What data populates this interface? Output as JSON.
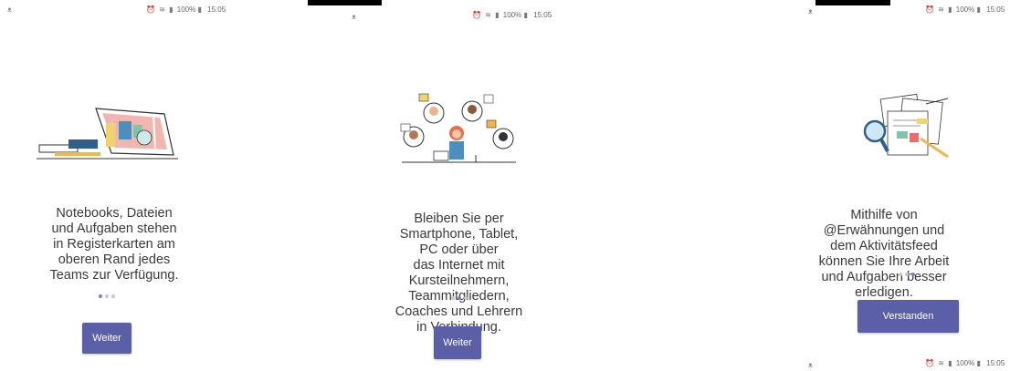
{
  "status": {
    "left_icon": "ᴥ",
    "signal": "100%",
    "time": "15:05"
  },
  "screens": [
    {
      "lines": [
        "Notebooks, Dateien",
        "und Aufgaben stehen",
        "in Registerkarten am",
        "oberen Rand jedes",
        "Teams zur Verfügung."
      ],
      "button": "Weiter",
      "active_dot": 0
    },
    {
      "lines": [
        "Bleiben Sie per",
        "Smartphone, Tablet,",
        "PC oder über",
        "das Internet mit",
        "Kursteilnehmern,",
        "Teammitgliedern,",
        "Coaches und Lehrern",
        "in Verbindung."
      ],
      "button": "Weiter",
      "active_dot": 1
    },
    {
      "lines": [
        "Mithilfe von",
        "@Erwähnungen und",
        "dem Aktivitätsfeed",
        "können Sie Ihre Arbeit",
        "und Aufgaben besser",
        "erledigen."
      ],
      "button": "Verstanden",
      "active_dot": 2
    }
  ],
  "colors": {
    "accent": "#5b5fa8",
    "dot_active": "#7b7fc9",
    "dot": "#c5c6e6"
  },
  "icons": [
    "notebook-illustration",
    "people-network-illustration",
    "documents-search-illustration"
  ]
}
